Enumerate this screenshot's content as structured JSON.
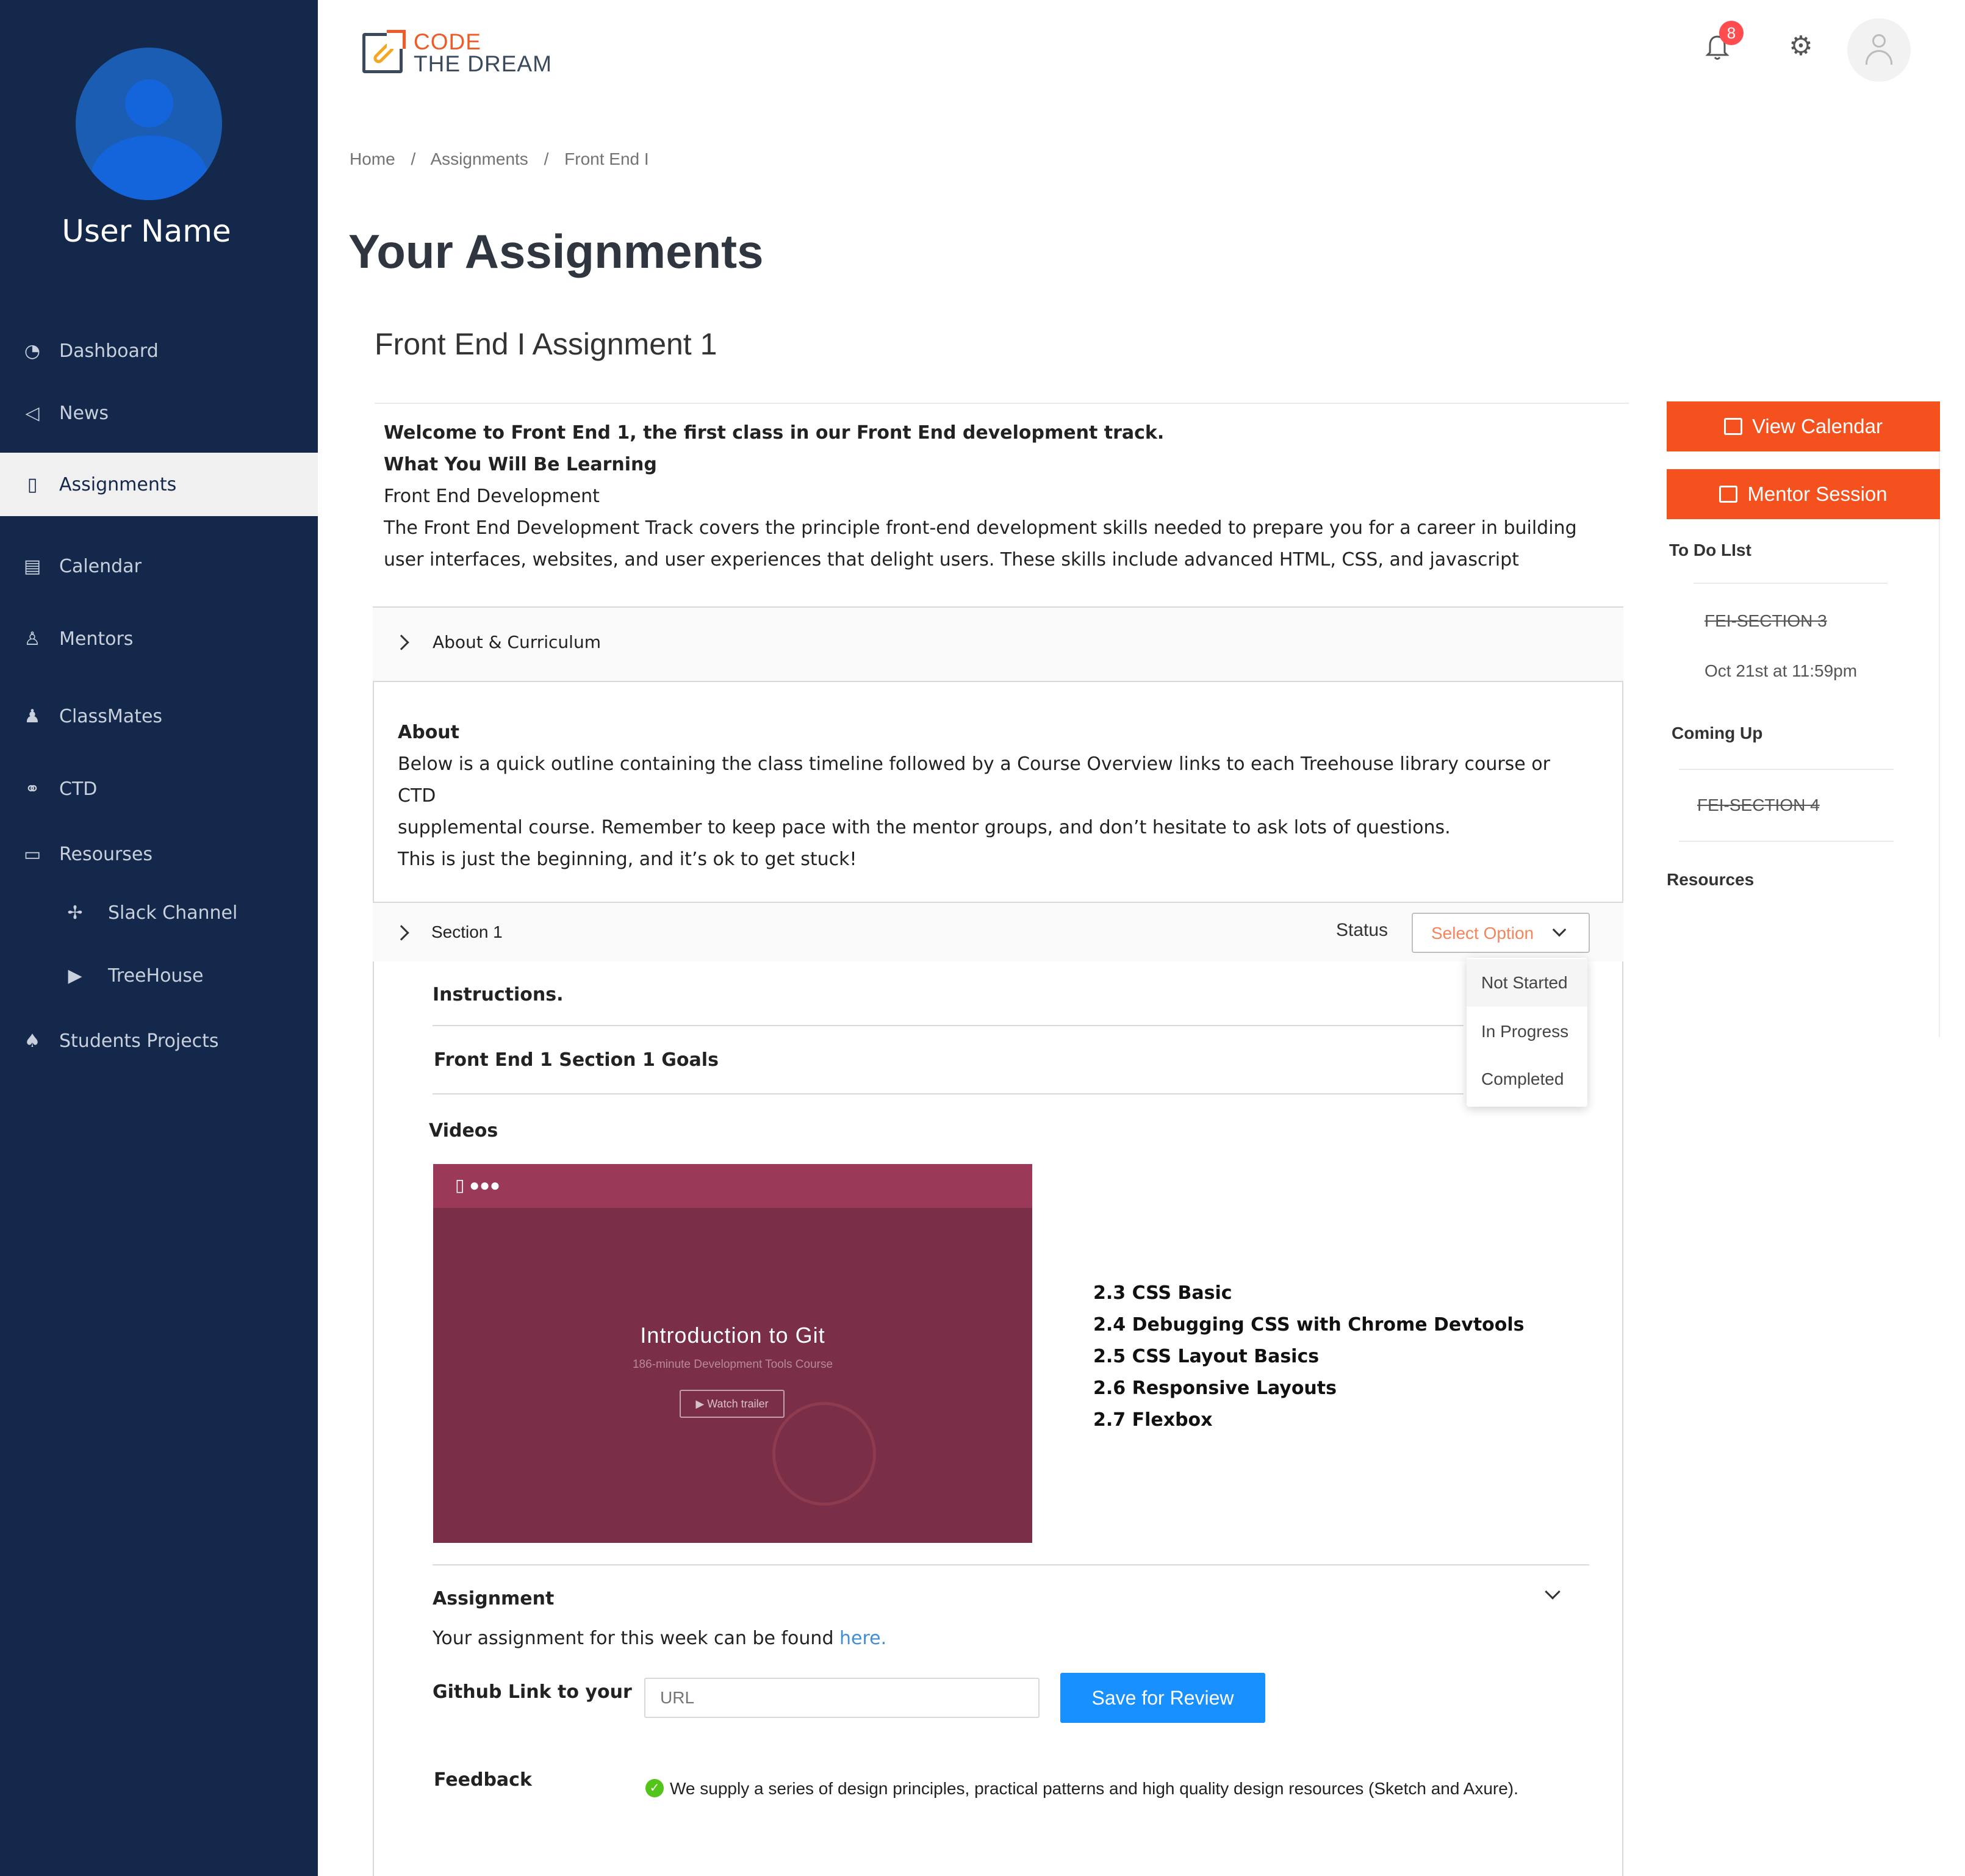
{
  "sidebar": {
    "user_name": "User Name",
    "items": [
      {
        "label": "Dashboard"
      },
      {
        "label": "News"
      },
      {
        "label": "Assignments"
      },
      {
        "label": "Calendar"
      },
      {
        "label": "Mentors"
      },
      {
        "label": "ClassMates"
      },
      {
        "label": "CTD"
      },
      {
        "label": "Resourses"
      },
      {
        "label": "Slack Channel"
      },
      {
        "label": "TreeHouse"
      },
      {
        "label": "Students Projects"
      }
    ]
  },
  "header": {
    "logo_line1": "CODE",
    "logo_line2": "THE DREAM",
    "notification_count": "8"
  },
  "breadcrumb": [
    "Home",
    "/",
    "Assignments",
    "/",
    "Front End I"
  ],
  "page_title": "Your Assignments",
  "assignment_title": "Front End I Assignment 1",
  "intro": {
    "welcome": "Welcome to Front End 1, the first class in our Front End development track.",
    "learning_heading": "What You Will Be Learning",
    "track": "Front End Development",
    "desc_line1": "The Front End Development Track covers the principle front-end development skills needed to prepare you for a career in building",
    "desc_line2": "user interfaces, websites, and user experiences that delight users. These skills include advanced HTML, CSS, and javascript"
  },
  "about_panel": {
    "header": "About  & Curriculum",
    "heading": "About",
    "line1": "Below is a quick outline containing the class timeline followed by a Course Overview links to each Treehouse library course or",
    "line2": "CTD",
    "line3": "supplemental course. Remember to keep pace with the mentor groups, and don’t hesitate to ask lots of questions.",
    "line4": "This is just the beginning, and it’s ok to get stuck!"
  },
  "section1": {
    "header": "Section 1",
    "status_label": "Status",
    "select_placeholder": "Select Option",
    "options": [
      "Not Started",
      "In Progress",
      "Completed"
    ],
    "instructions": "Instructions.",
    "goals": "Front End 1 Section 1 Goals",
    "videos_heading": "Videos",
    "video": {
      "title": "Introduction to Git",
      "subtitle": "186-minute Development Tools Course",
      "button": "▶ Watch trailer"
    },
    "video_links": [
      "2.3 CSS Basic",
      "2.4 Debugging CSS with Chrome Devtools",
      "2.5 CSS Layout Basics",
      "2.6 Responsive Layouts",
      "2.7 Flexbox"
    ],
    "assignment_heading": "Assignment",
    "assignment_text": "Your assignment for this week can be found ",
    "assignment_link": "here.",
    "github_label": "Github Link to your",
    "url_placeholder": "URL",
    "save_button": "Save for Review",
    "feedback_label": "Feedback",
    "feedback_text": "We supply a series of design principles, practical patterns and high quality design resources (Sketch and Axure)."
  },
  "right": {
    "view_calendar": "View Calendar",
    "mentor_session": "Mentor Session",
    "todo_heading": "To Do LIst",
    "todo_item": "FEI-SECTION 3",
    "todo_due": "Oct 21st at 11:59pm",
    "coming_heading": "Coming Up",
    "coming_item": "FEI-SECTION 4",
    "resources_heading": "Resources"
  },
  "colors": {
    "sidebar_bg": "#14284b",
    "accent_orange": "#f4511e",
    "primary_blue": "#1890ff",
    "badge_red": "#ff4d4f"
  }
}
